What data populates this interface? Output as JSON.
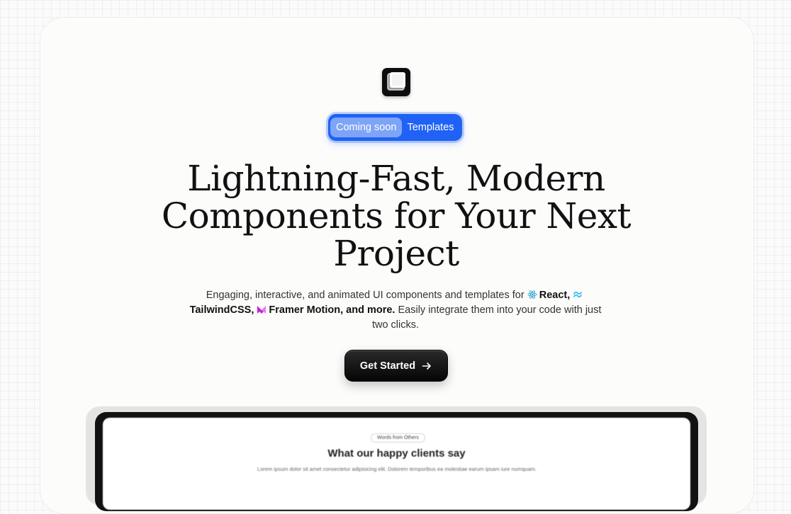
{
  "badge": {
    "tag": "Coming soon",
    "label": "Templates"
  },
  "hero": {
    "title": "Lightning-Fast, Modern Components for Your Next Project",
    "description": {
      "intro": "Engaging, interactive, and animated UI components and templates for ",
      "tech_react": "React,",
      "tech_tailwind": "TailwindCSS,",
      "tech_framer": "Framer Motion, and more.",
      "outro": " Easily integrate them into your code with just two clicks."
    },
    "cta_label": "Get Started"
  },
  "preview": {
    "chip": "Words from Others",
    "title": "What our happy clients say",
    "body": "Lorem ipsum dolor sit amet consectetur adipisicing elit. Dolorem temporibus ea molestiae earum ipsam iure numquam."
  },
  "icons": {
    "logo": "square-logo-icon",
    "react": "react-icon",
    "tailwind": "tailwind-icon",
    "framer": "framer-motion-icon",
    "cta": "arrow-right-icon"
  },
  "colors": {
    "accent": "#1f62f5",
    "badge_tag_bg": "#7ea4f7",
    "react": "#3ca7d6",
    "tailwind": "#38bdf8",
    "framer": "#c026d3",
    "cta_bg": "#0a0a0a"
  }
}
